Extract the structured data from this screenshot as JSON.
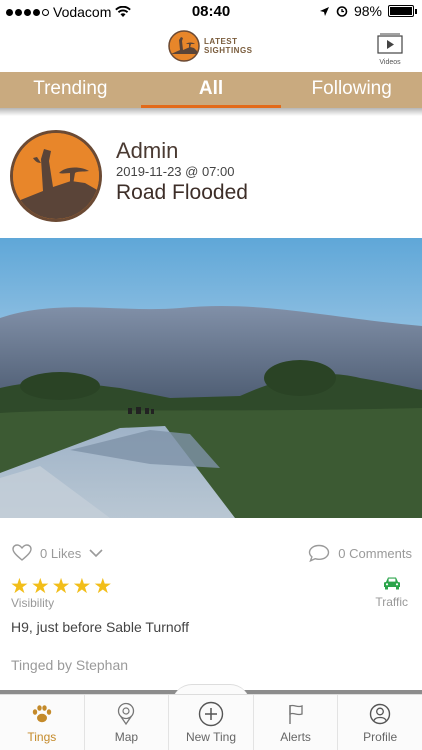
{
  "status": {
    "carrier": "Vodacom",
    "time": "08:40",
    "battery": "98%"
  },
  "header": {
    "logo_line1": "LATEST",
    "logo_line2": "SIGHTINGS",
    "videos_label": "Videos"
  },
  "tabs": [
    {
      "label": "Trending",
      "active": false
    },
    {
      "label": "All",
      "active": true
    },
    {
      "label": "Following",
      "active": false
    }
  ],
  "post": {
    "user": "Admin",
    "date": "2019-11-23 @ 07:00",
    "title": "Road Flooded",
    "likes": "0 Likes",
    "comments": "0 Comments",
    "visibility_rating": 5,
    "visibility_label": "Visibility",
    "category": "Traffic",
    "location": "H9, just before Sable Turnoff",
    "tinged_by": "Tinged by Stephan"
  },
  "nav": [
    {
      "label": "Tings",
      "icon": "paw-icon",
      "active": true
    },
    {
      "label": "Map",
      "icon": "map-icon",
      "active": false
    },
    {
      "label": "New Ting",
      "icon": "plus-circle-icon",
      "active": false
    },
    {
      "label": "Alerts",
      "icon": "flag-icon",
      "active": false
    },
    {
      "label": "Profile",
      "icon": "user-icon",
      "active": false
    }
  ],
  "colors": {
    "tab_bar": "#c9aa7f",
    "tab_active_underline": "#e26a1a",
    "star": "#f2be1a",
    "nav_active": "#c48a2a",
    "traffic_icon": "#2aa44a"
  }
}
